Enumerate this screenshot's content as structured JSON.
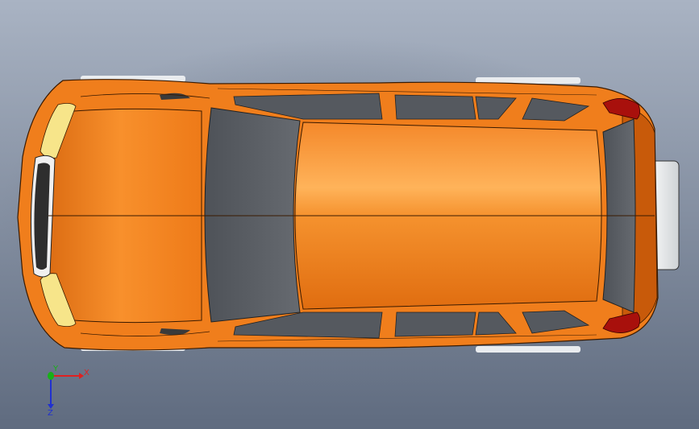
{
  "viewport": {
    "background_top": "#a9b3c3",
    "background_bottom": "#5f6b7f",
    "model": {
      "body_color": "#f07e1c",
      "body_highlight": "#ffb35a",
      "body_shadow": "#b54f08",
      "glass_color": "#5b5f66",
      "tail_light_color": "#a8100c",
      "head_light_color": "#f7e58a",
      "spare_tire_color": "#f2f2f2"
    }
  },
  "triad": {
    "x_label": "X",
    "y_label": "Y",
    "z_label": "Z",
    "x_color": "#e02020",
    "y_color": "#18b018",
    "z_color": "#2030d0"
  }
}
